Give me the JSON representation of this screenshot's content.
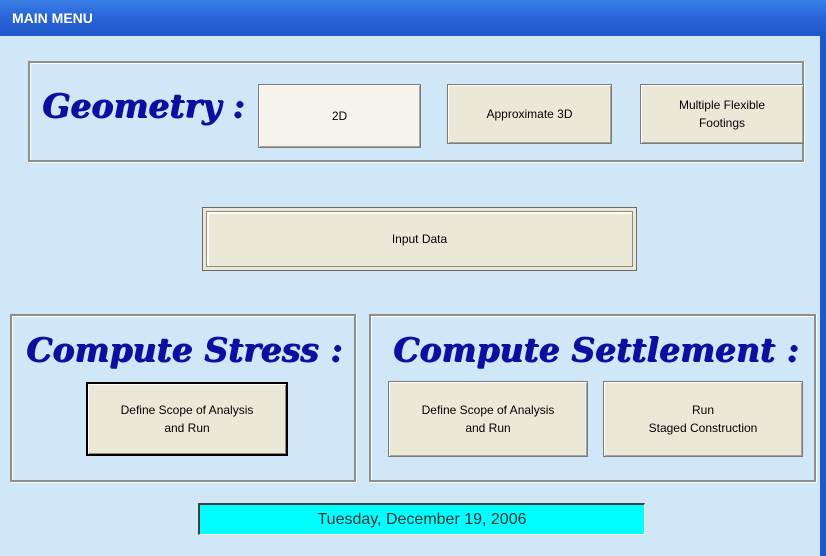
{
  "window": {
    "title": "MAIN MENU"
  },
  "geometry": {
    "heading": "Geometry :",
    "buttons": [
      "2D",
      "Approximate 3D",
      "Multiple Flexible\nFootings"
    ],
    "selected": "2D"
  },
  "input": {
    "button": "Input Data"
  },
  "stress": {
    "heading": "Compute Stress :",
    "button": "Define Scope of Analysis\nand Run"
  },
  "settlement": {
    "heading": "Compute Settlement :",
    "define_button": "Define Scope of Analysis\nand Run",
    "run_button": "Run\nStaged Construction"
  },
  "status": {
    "date": "Tuesday, December 19, 2006"
  },
  "colors": {
    "background": "#cfe7f7",
    "titlebar": "#2a66d9",
    "heading": "#0c10a0",
    "date_background": "#00ffff"
  }
}
